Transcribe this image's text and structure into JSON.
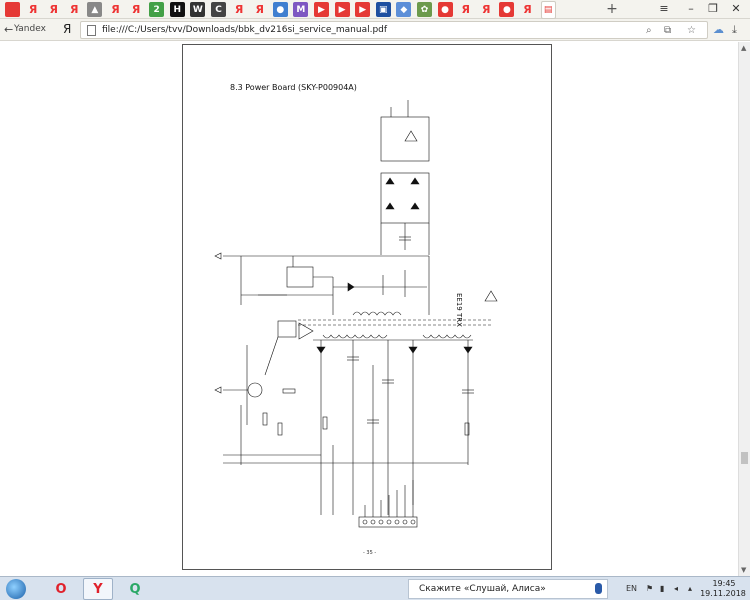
{
  "browser": {
    "tabs": [
      {
        "icon": "red-square",
        "color": "#e53935"
      },
      {
        "icon": "yandex-logo",
        "label": "Я"
      },
      {
        "icon": "yandex-logo",
        "label": "Я"
      },
      {
        "icon": "yandex-logo",
        "label": "Я"
      },
      {
        "icon": "drive-icon",
        "color": "#888888"
      },
      {
        "icon": "yandex-logo",
        "label": "Я"
      },
      {
        "icon": "yandex-logo",
        "label": "Я"
      },
      {
        "icon": "green-2-icon",
        "color": "#43a047"
      },
      {
        "icon": "black-h-icon",
        "color": "#111111"
      },
      {
        "icon": "www-icon",
        "color": "#333333"
      },
      {
        "icon": "c-icon",
        "color": "#444444"
      },
      {
        "icon": "yandex-logo",
        "label": "Я"
      },
      {
        "icon": "yandex-logo",
        "label": "Я"
      },
      {
        "icon": "blue-dot-icon",
        "color": "#3f7fd0"
      },
      {
        "icon": "purple-m-icon",
        "color": "#7e57c2"
      },
      {
        "icon": "youtube-icon",
        "color": "#e53935"
      },
      {
        "icon": "youtube-icon",
        "color": "#e53935"
      },
      {
        "icon": "youtube-icon",
        "color": "#e53935"
      },
      {
        "icon": "blue-square-icon",
        "color": "#1e4fa0"
      },
      {
        "icon": "blue-white-icon",
        "color": "#5d8fd8"
      },
      {
        "icon": "green-tile-icon",
        "color": "#6c9a4c"
      },
      {
        "icon": "red-circle-icon",
        "color": "#e53935"
      },
      {
        "icon": "yandex-logo",
        "label": "Я"
      },
      {
        "icon": "yandex-logo",
        "label": "Я"
      },
      {
        "icon": "red-circle-icon",
        "color": "#e53935"
      },
      {
        "icon": "yandex-logo",
        "label": "Я"
      },
      {
        "icon": "pdf-icon",
        "color": "#e53935",
        "active": true
      }
    ],
    "new_tab_label": "+",
    "window_controls": {
      "menu": "≡",
      "minimize": "–",
      "maximize": "❐",
      "close": "✕"
    },
    "back_label": "←",
    "yandex_label": "Yandex",
    "ya_logo": "Я",
    "url": "file:///C:/Users/tvv/Downloads/bbk_dv216si_service_manual.pdf"
  },
  "document": {
    "title": "8.3 Power  Board (SKY-P00904A)",
    "page_number": "- 35 -"
  },
  "taskbar": {
    "apps": [
      {
        "name": "opera",
        "glyph": "O",
        "color": "#e0212b"
      },
      {
        "name": "yandex-browser",
        "glyph": "Y",
        "color": "#e0212b",
        "active": true
      },
      {
        "name": "q-app",
        "glyph": "Q",
        "color": "#2aa866"
      }
    ],
    "alice_placeholder": "Скажите «Слушай, Алиса»",
    "language": "EN",
    "time": "19:45",
    "date": "19.11.2018"
  }
}
